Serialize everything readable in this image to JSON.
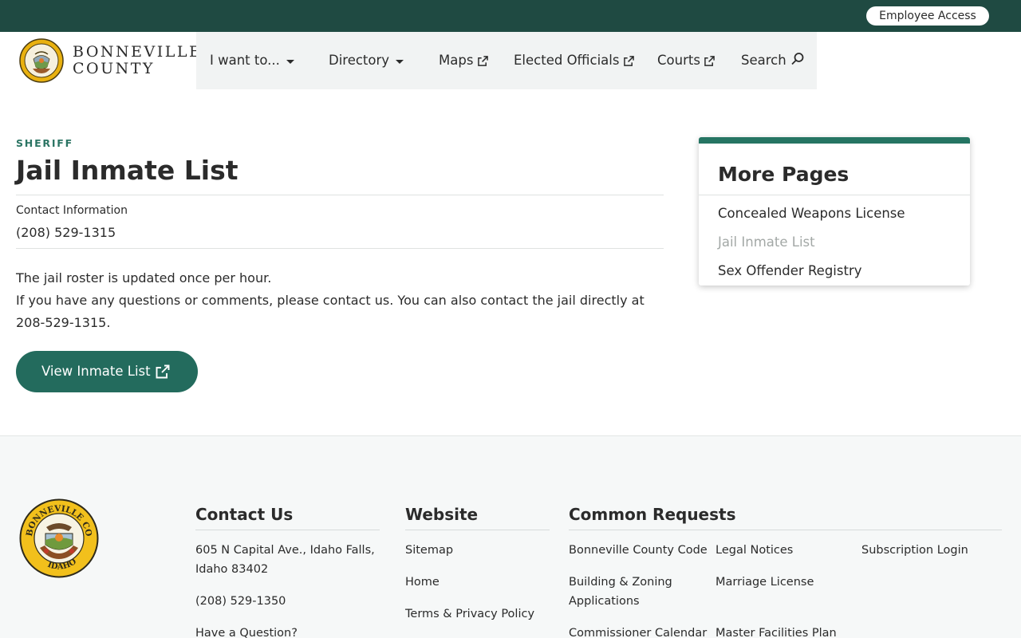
{
  "topbar": {
    "employee_access": "Employee Access"
  },
  "logo": {
    "line1": "BONNEVILLE",
    "line2": "COUNTY"
  },
  "nav": {
    "i_want_to": "I want to...",
    "directory": "Directory",
    "maps": "Maps",
    "elected_officials": "Elected Officials",
    "courts": "Courts",
    "search": "Search"
  },
  "main": {
    "eyebrow": "SHERIFF",
    "title": "Jail Inmate List",
    "contact_label": "Contact Information",
    "contact_phone": "(208) 529-1315",
    "paragraph1": "The jail roster is updated once per hour.",
    "paragraph2": "If you have any questions or comments, please contact us. You can also contact the jail directly at 208-529-1315.",
    "view_button": "View Inmate List"
  },
  "more_pages": {
    "title": "More Pages",
    "items": [
      {
        "label": "Concealed Weapons License",
        "current": false
      },
      {
        "label": "Jail Inmate List",
        "current": true
      },
      {
        "label": "Sex Offender Registry",
        "current": false
      }
    ]
  },
  "footer": {
    "contact": {
      "heading": "Contact Us",
      "address": "605 N Capital Ave., Idaho Falls, Idaho 83402",
      "phone": "(208) 529-1350",
      "question": "Have a Question?"
    },
    "website": {
      "heading": "Website",
      "links": [
        "Sitemap",
        "Home",
        "Terms & Privacy Policy"
      ]
    },
    "common": {
      "heading": "Common Requests",
      "links": [
        "Bonneville County Code",
        "Legal Notices",
        "Subscription Login",
        "Building & Zoning Applications",
        "Marriage License",
        "Commissioner Calendar",
        "Master Facilities Plan"
      ]
    },
    "seal_text": {
      "top": "BONNEVILLE COUNTY",
      "bottom": "IDAHO"
    }
  },
  "colors": {
    "topbar": "#1f4a42",
    "accent": "#236b5d",
    "eyebrow": "#2c7564",
    "nav_bg": "#f1f3f3",
    "footer_bg": "#f6f8f8"
  },
  "icons": [
    "seal-logo-icon",
    "caret-down-icon",
    "external-link-icon",
    "search-icon"
  ]
}
